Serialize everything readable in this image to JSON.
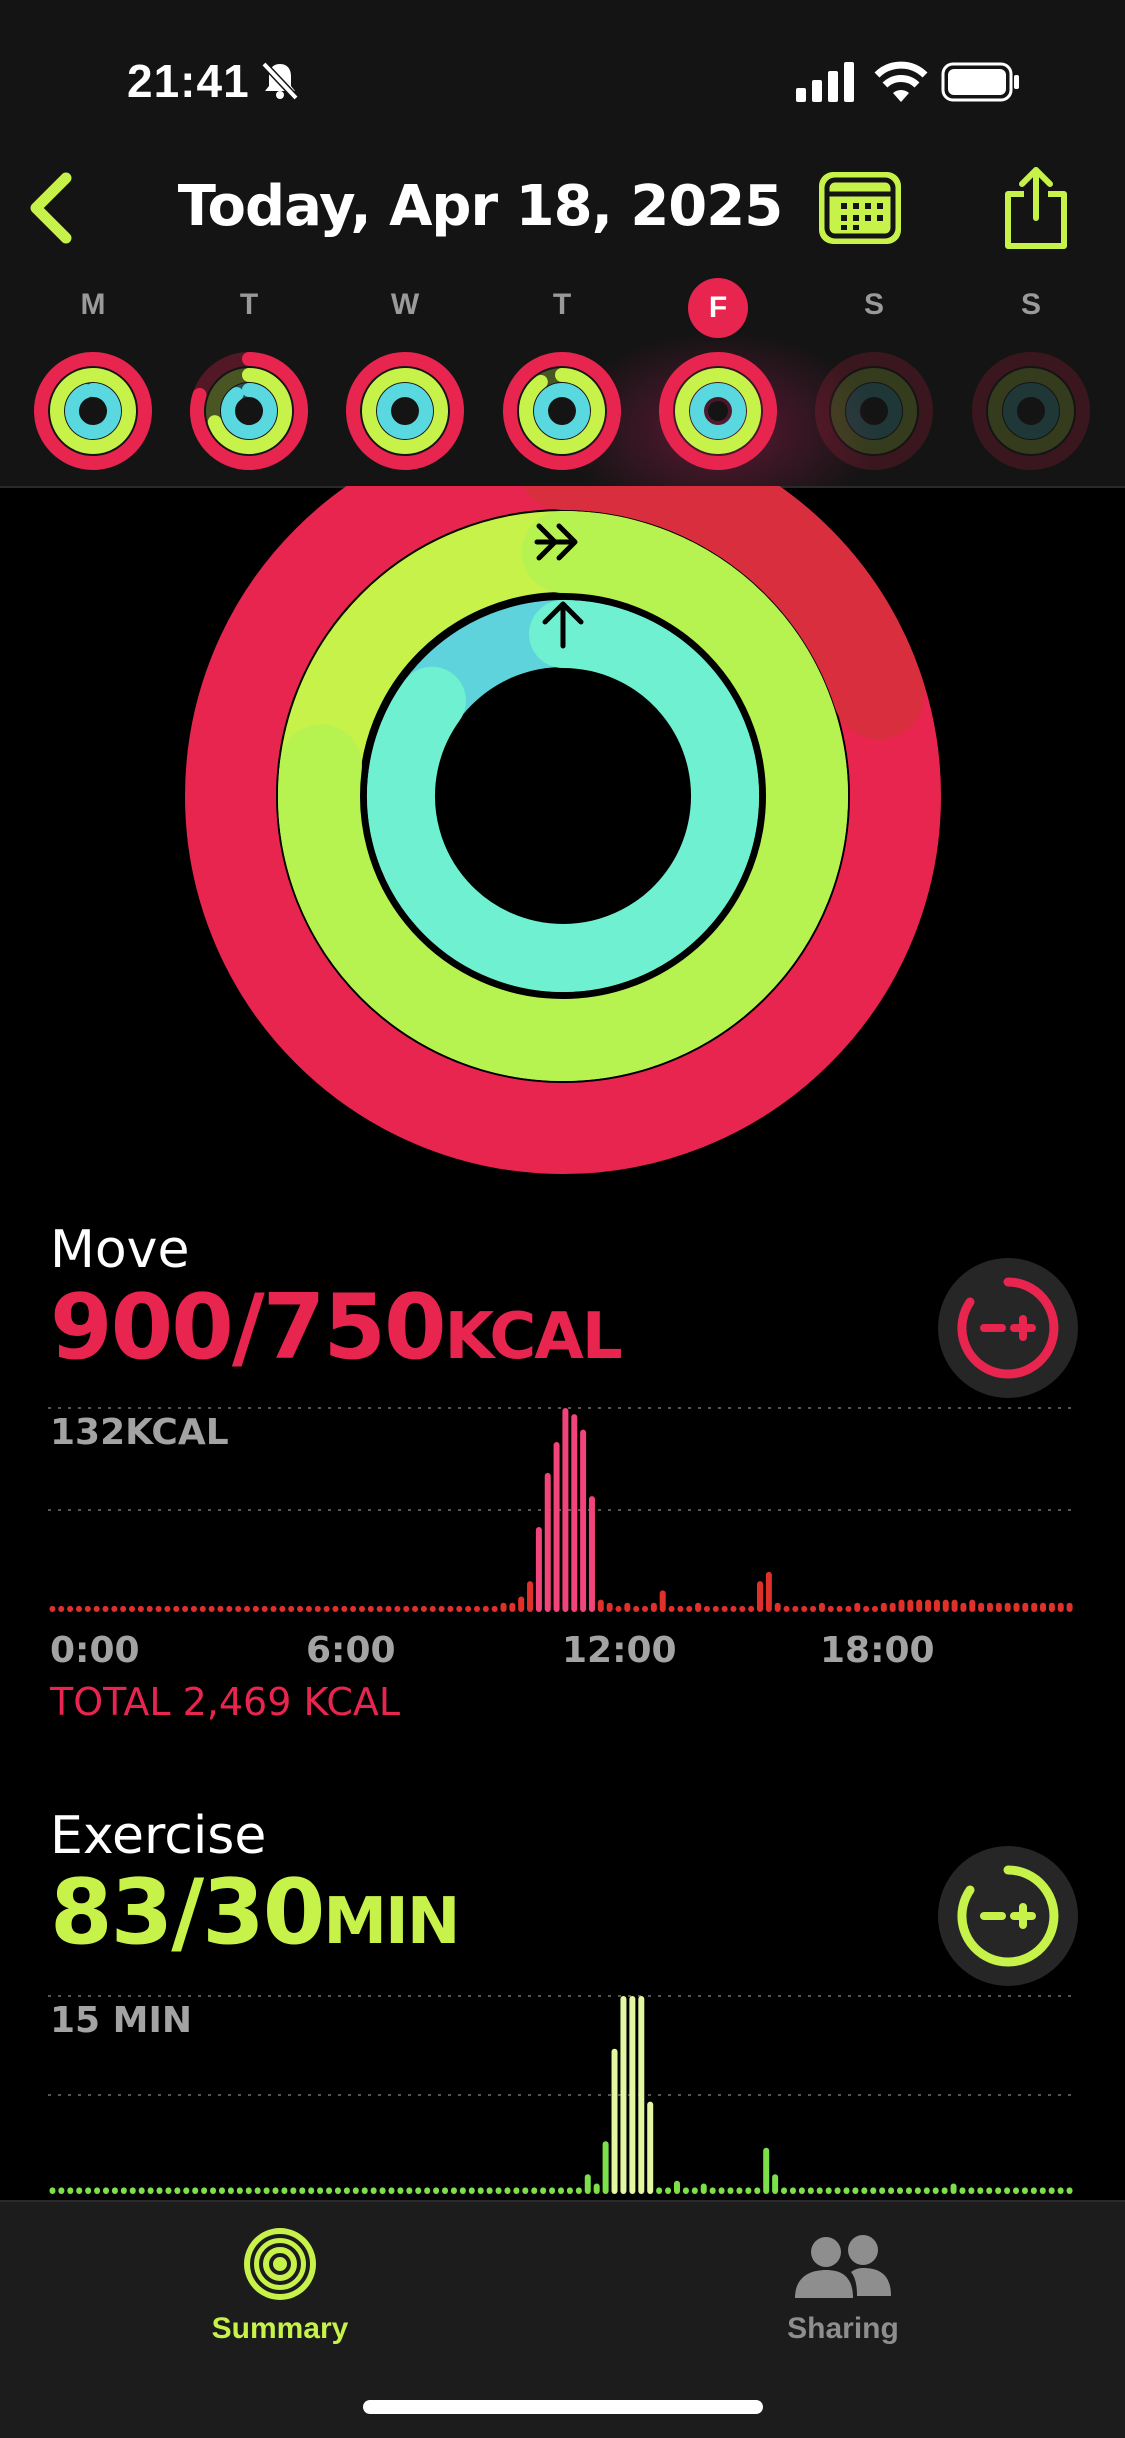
{
  "status_bar": {
    "time": "21:41"
  },
  "header": {
    "title": "Today, Apr 18, 2025"
  },
  "week": [
    {
      "letter": "M",
      "selected": false,
      "move": 1.0,
      "exercise": 1.0,
      "stand": 0.95,
      "faded": false
    },
    {
      "letter": "T",
      "selected": false,
      "move": 0.8,
      "exercise": 0.7,
      "stand": 0.9,
      "faded": false
    },
    {
      "letter": "W",
      "selected": false,
      "move": 1.0,
      "exercise": 1.0,
      "stand": 1.0,
      "faded": false
    },
    {
      "letter": "T",
      "selected": false,
      "move": 1.0,
      "exercise": 0.9,
      "stand": 1.0,
      "faded": false
    },
    {
      "letter": "F",
      "selected": true,
      "move": 1.0,
      "exercise": 1.0,
      "stand": 1.0,
      "faded": false
    },
    {
      "letter": "S",
      "selected": false,
      "move": 0,
      "exercise": 0,
      "stand": 0,
      "faded": true
    },
    {
      "letter": "S",
      "selected": false,
      "move": 0,
      "exercise": 0,
      "stand": 0,
      "faded": true
    }
  ],
  "rings": {
    "move_progress": 1.2,
    "exercise_progress": 2.77,
    "stand_progress": 0.85
  },
  "move": {
    "label": "Move",
    "value": "900/750",
    "unit": "KCAL",
    "max_label": "132KCAL",
    "total": "TOTAL 2,469 KCAL",
    "color": "#e8254f"
  },
  "exercise": {
    "label": "Exercise",
    "value": "83/30",
    "unit": "MIN",
    "max_label": "15 MIN",
    "color": "#c6f24a"
  },
  "x_ticks": [
    "0:00",
    "6:00",
    "12:00",
    "18:00"
  ],
  "tabs": {
    "summary": "Summary",
    "sharing": "Sharing"
  },
  "chart_data": [
    {
      "type": "bar",
      "title": "Move",
      "ylabel": "132KCAL",
      "xticks": [
        "0:00",
        "6:00",
        "12:00",
        "18:00"
      ],
      "ylim": [
        0,
        132
      ],
      "values": [
        4,
        4,
        4,
        4,
        4,
        4,
        4,
        4,
        4,
        4,
        4,
        4,
        4,
        4,
        4,
        4,
        4,
        4,
        4,
        4,
        4,
        4,
        4,
        4,
        4,
        4,
        4,
        4,
        4,
        4,
        4,
        4,
        4,
        4,
        4,
        4,
        4,
        4,
        4,
        4,
        4,
        4,
        4,
        4,
        4,
        4,
        4,
        4,
        4,
        4,
        4,
        6,
        6,
        10,
        20,
        55,
        90,
        110,
        132,
        128,
        118,
        75,
        8,
        6,
        4,
        6,
        4,
        4,
        6,
        14,
        4,
        4,
        4,
        6,
        4,
        4,
        4,
        4,
        4,
        4,
        20,
        26,
        6,
        4,
        4,
        4,
        4,
        6,
        4,
        4,
        4,
        6,
        4,
        4,
        6,
        6,
        8,
        8,
        8,
        8,
        8,
        8,
        8,
        6,
        8,
        6,
        6,
        6,
        6,
        6,
        6,
        6,
        6,
        6,
        6,
        6
      ]
    },
    {
      "type": "bar",
      "title": "Exercise",
      "ylabel": "15 MIN",
      "ylim": [
        0,
        15
      ],
      "values": [
        0.5,
        0.5,
        0.5,
        0.5,
        0.5,
        0.5,
        0.5,
        0.5,
        0.5,
        0.5,
        0.5,
        0.5,
        0.5,
        0.5,
        0.5,
        0.5,
        0.5,
        0.5,
        0.5,
        0.5,
        0.5,
        0.5,
        0.5,
        0.5,
        0.5,
        0.5,
        0.5,
        0.5,
        0.5,
        0.5,
        0.5,
        0.5,
        0.5,
        0.5,
        0.5,
        0.5,
        0.5,
        0.5,
        0.5,
        0.5,
        0.5,
        0.5,
        0.5,
        0.5,
        0.5,
        0.5,
        0.5,
        0.5,
        0.5,
        0.5,
        0.5,
        0.5,
        0.5,
        0.5,
        0.5,
        0.5,
        0.5,
        0.5,
        0.5,
        0.5,
        1.5,
        0.8,
        4,
        11,
        15,
        15,
        15,
        7,
        0.5,
        0.5,
        1,
        0.5,
        0.5,
        0.8,
        0.5,
        0.5,
        0.5,
        0.5,
        0.5,
        0.5,
        3.5,
        1.5,
        0.5,
        0.5,
        0.5,
        0.5,
        0.5,
        0.5,
        0.5,
        0.5,
        0.5,
        0.5,
        0.5,
        0.5,
        0.5,
        0.5,
        0.5,
        0.5,
        0.5,
        0.5,
        0.5,
        0.8,
        0.5,
        0.5,
        0.5,
        0.5,
        0.5,
        0.5,
        0.5,
        0.5,
        0.5,
        0.5,
        0.5,
        0.5,
        0.5
      ]
    }
  ]
}
